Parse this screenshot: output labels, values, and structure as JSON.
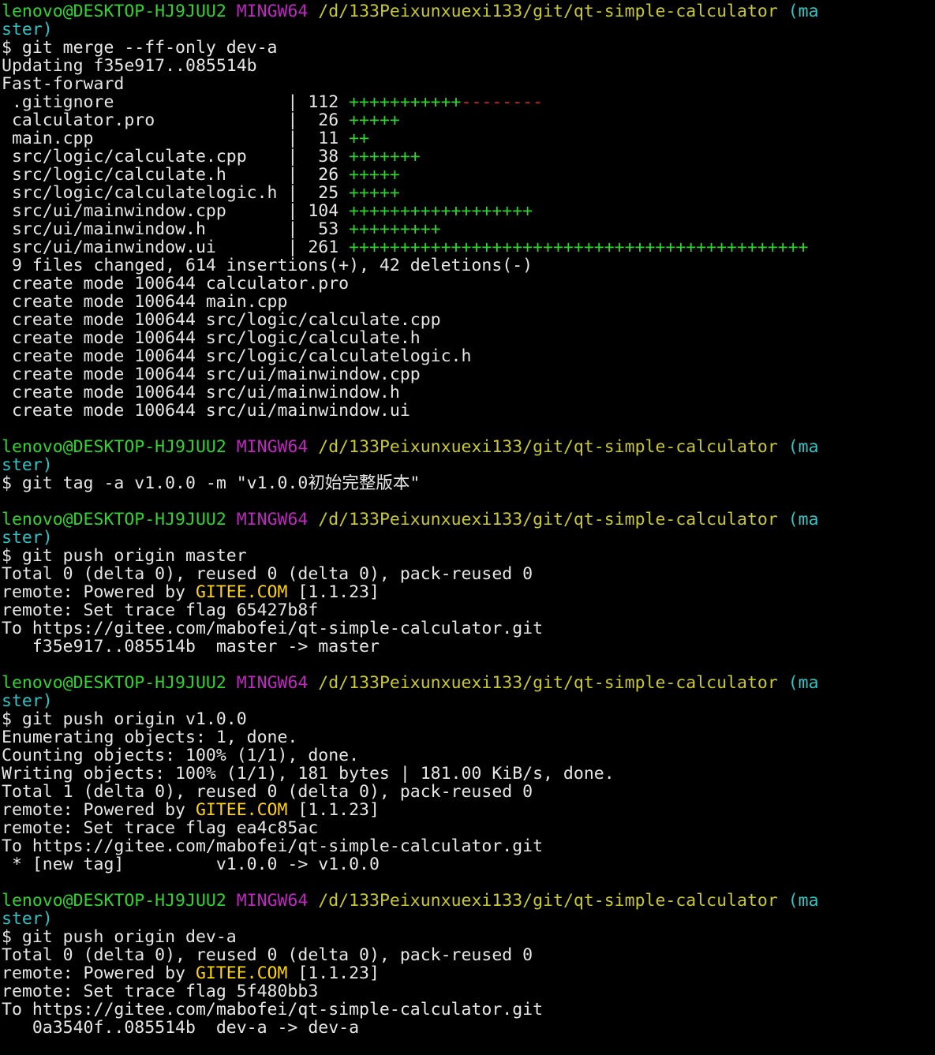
{
  "lines": [
    [
      {
        "t": "lenovo@DESKTOP-HJ9JUU2",
        "c": "green"
      },
      {
        "t": " "
      },
      {
        "t": "MINGW64",
        "c": "purple"
      },
      {
        "t": " "
      },
      {
        "t": "/d/133Peixunxuexi133/git/qt-simple-calculator",
        "c": "yellow"
      },
      {
        "t": " "
      },
      {
        "t": "(ma",
        "c": "cyan"
      }
    ],
    [
      {
        "t": "ster)",
        "c": "cyan"
      }
    ],
    [
      {
        "t": "$ git merge --ff-only dev-a"
      }
    ],
    [
      {
        "t": "Updating f35e917..085514b"
      }
    ],
    [
      {
        "t": "Fast-forward"
      }
    ],
    [
      {
        "t": " .gitignore                 | 112 "
      },
      {
        "t": "+++++++++++",
        "c": "green"
      },
      {
        "t": "--------",
        "c": "red"
      }
    ],
    [
      {
        "t": " calculator.pro             |  26 "
      },
      {
        "t": "+++++",
        "c": "green"
      }
    ],
    [
      {
        "t": " main.cpp                   |  11 "
      },
      {
        "t": "++",
        "c": "green"
      }
    ],
    [
      {
        "t": " src/logic/calculate.cpp    |  38 "
      },
      {
        "t": "+++++++",
        "c": "green"
      }
    ],
    [
      {
        "t": " src/logic/calculate.h      |  26 "
      },
      {
        "t": "+++++",
        "c": "green"
      }
    ],
    [
      {
        "t": " src/logic/calculatelogic.h |  25 "
      },
      {
        "t": "+++++",
        "c": "green"
      }
    ],
    [
      {
        "t": " src/ui/mainwindow.cpp      | 104 "
      },
      {
        "t": "++++++++++++++++++",
        "c": "green"
      }
    ],
    [
      {
        "t": " src/ui/mainwindow.h        |  53 "
      },
      {
        "t": "+++++++++",
        "c": "green"
      }
    ],
    [
      {
        "t": " src/ui/mainwindow.ui       | 261 "
      },
      {
        "t": "+++++++++++++++++++++++++++++++++++++++++++++",
        "c": "green"
      }
    ],
    [
      {
        "t": " 9 files changed, 614 insertions(+), 42 deletions(-)"
      }
    ],
    [
      {
        "t": " create mode 100644 calculator.pro"
      }
    ],
    [
      {
        "t": " create mode 100644 main.cpp"
      }
    ],
    [
      {
        "t": " create mode 100644 src/logic/calculate.cpp"
      }
    ],
    [
      {
        "t": " create mode 100644 src/logic/calculate.h"
      }
    ],
    [
      {
        "t": " create mode 100644 src/logic/calculatelogic.h"
      }
    ],
    [
      {
        "t": " create mode 100644 src/ui/mainwindow.cpp"
      }
    ],
    [
      {
        "t": " create mode 100644 src/ui/mainwindow.h"
      }
    ],
    [
      {
        "t": " create mode 100644 src/ui/mainwindow.ui"
      }
    ],
    [],
    [
      {
        "t": "lenovo@DESKTOP-HJ9JUU2",
        "c": "green"
      },
      {
        "t": " "
      },
      {
        "t": "MINGW64",
        "c": "purple"
      },
      {
        "t": " "
      },
      {
        "t": "/d/133Peixunxuexi133/git/qt-simple-calculator",
        "c": "yellow"
      },
      {
        "t": " "
      },
      {
        "t": "(ma",
        "c": "cyan"
      }
    ],
    [
      {
        "t": "ster)",
        "c": "cyan"
      }
    ],
    [
      {
        "t": "$ git tag -a v1.0.0 -m \"v1.0.0初始完整版本\""
      }
    ],
    [],
    [
      {
        "t": "lenovo@DESKTOP-HJ9JUU2",
        "c": "green"
      },
      {
        "t": " "
      },
      {
        "t": "MINGW64",
        "c": "purple"
      },
      {
        "t": " "
      },
      {
        "t": "/d/133Peixunxuexi133/git/qt-simple-calculator",
        "c": "yellow"
      },
      {
        "t": " "
      },
      {
        "t": "(ma",
        "c": "cyan"
      }
    ],
    [
      {
        "t": "ster)",
        "c": "cyan"
      }
    ],
    [
      {
        "t": "$ git push origin master"
      }
    ],
    [
      {
        "t": "Total 0 (delta 0), reused 0 (delta 0), pack-reused 0"
      }
    ],
    [
      {
        "t": "remote: Powered by "
      },
      {
        "t": "GITEE.COM",
        "c": "gitee"
      },
      {
        "t": " [1.1.23]"
      }
    ],
    [
      {
        "t": "remote: Set trace flag 65427b8f"
      }
    ],
    [
      {
        "t": "To https://gitee.com/mabofei/qt-simple-calculator.git"
      }
    ],
    [
      {
        "t": "   f35e917..085514b  master -> master"
      }
    ],
    [],
    [
      {
        "t": "lenovo@DESKTOP-HJ9JUU2",
        "c": "green"
      },
      {
        "t": " "
      },
      {
        "t": "MINGW64",
        "c": "purple"
      },
      {
        "t": " "
      },
      {
        "t": "/d/133Peixunxuexi133/git/qt-simple-calculator",
        "c": "yellow"
      },
      {
        "t": " "
      },
      {
        "t": "(ma",
        "c": "cyan"
      }
    ],
    [
      {
        "t": "ster)",
        "c": "cyan"
      }
    ],
    [
      {
        "t": "$ git push origin v1.0.0"
      }
    ],
    [
      {
        "t": "Enumerating objects: 1, done."
      }
    ],
    [
      {
        "t": "Counting objects: 100% (1/1), done."
      }
    ],
    [
      {
        "t": "Writing objects: 100% (1/1), 181 bytes | 181.00 KiB/s, done."
      }
    ],
    [
      {
        "t": "Total 1 (delta 0), reused 0 (delta 0), pack-reused 0"
      }
    ],
    [
      {
        "t": "remote: Powered by "
      },
      {
        "t": "GITEE.COM",
        "c": "gitee"
      },
      {
        "t": " [1.1.23]"
      }
    ],
    [
      {
        "t": "remote: Set trace flag ea4c85ac"
      }
    ],
    [
      {
        "t": "To https://gitee.com/mabofei/qt-simple-calculator.git"
      }
    ],
    [
      {
        "t": " * [new tag]         v1.0.0 -> v1.0.0"
      }
    ],
    [],
    [
      {
        "t": "lenovo@DESKTOP-HJ9JUU2",
        "c": "green"
      },
      {
        "t": " "
      },
      {
        "t": "MINGW64",
        "c": "purple"
      },
      {
        "t": " "
      },
      {
        "t": "/d/133Peixunxuexi133/git/qt-simple-calculator",
        "c": "yellow"
      },
      {
        "t": " "
      },
      {
        "t": "(ma",
        "c": "cyan"
      }
    ],
    [
      {
        "t": "ster)",
        "c": "cyan"
      }
    ],
    [
      {
        "t": "$ git push origin dev-a"
      }
    ],
    [
      {
        "t": "Total 0 (delta 0), reused 0 (delta 0), pack-reused 0"
      }
    ],
    [
      {
        "t": "remote: Powered by "
      },
      {
        "t": "GITEE.COM",
        "c": "gitee"
      },
      {
        "t": " [1.1.23]"
      }
    ],
    [
      {
        "t": "remote: Set trace flag 5f480bb3"
      }
    ],
    [
      {
        "t": "To https://gitee.com/mabofei/qt-simple-calculator.git"
      }
    ],
    [
      {
        "t": "   0a3540f..085514b  dev-a -> dev-a"
      }
    ]
  ],
  "colors": {
    "green": "#2fd42f",
    "purple": "#c026c0",
    "yellow": "#c9c92d",
    "cyan": "#2ec4c4",
    "red": "#d42020",
    "gitee": "#ffd400",
    "white": "#e6e6e6",
    "background": "#000000"
  }
}
